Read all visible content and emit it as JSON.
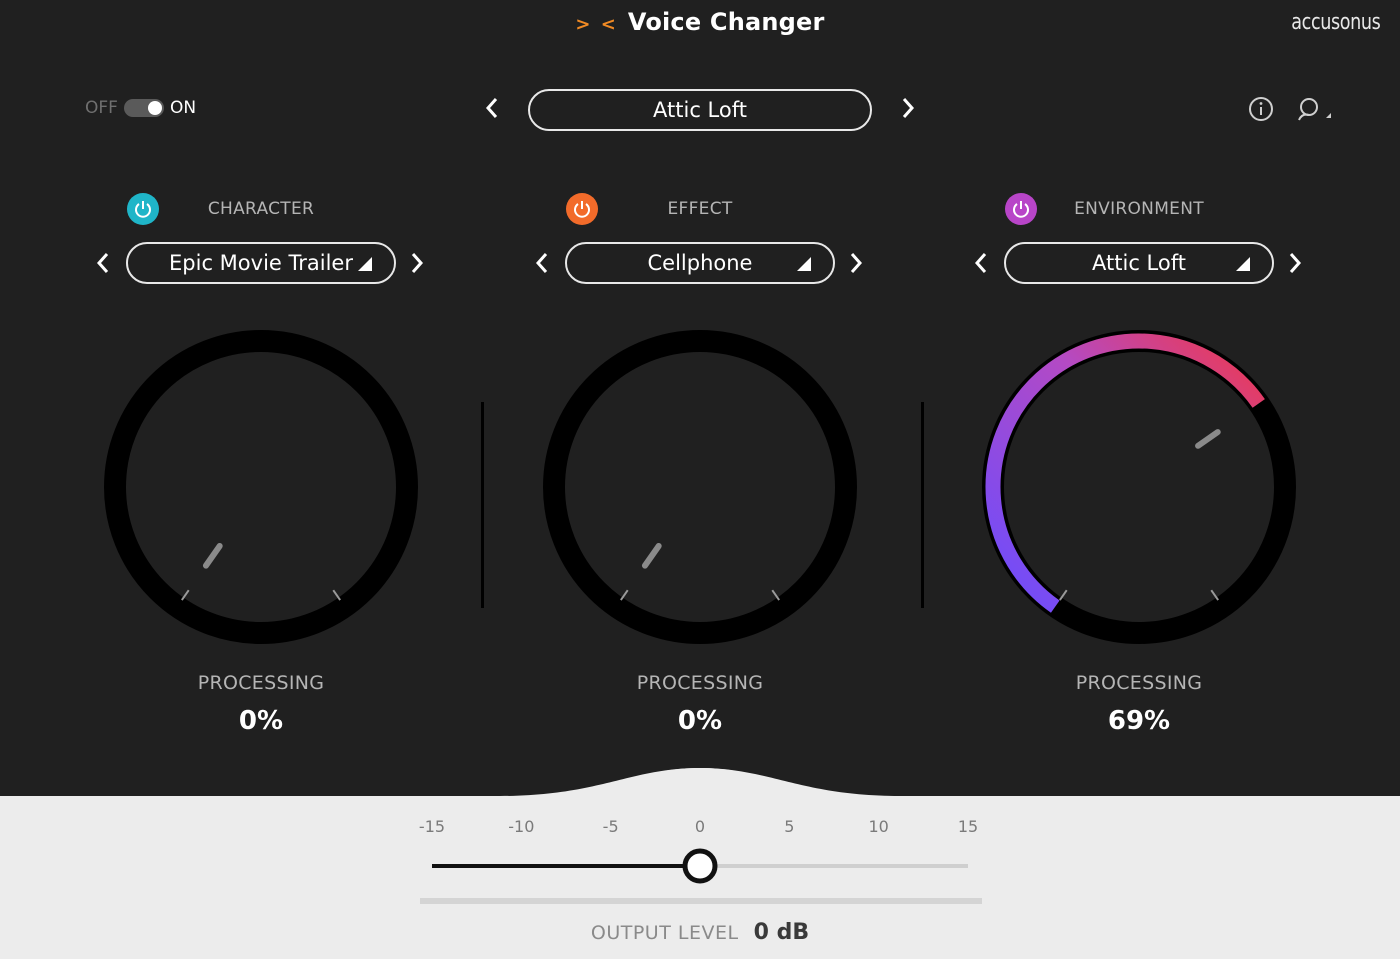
{
  "header": {
    "logo_glyph": "> <",
    "title": "Voice Changer",
    "brand": "accusonus"
  },
  "toggle": {
    "off_label": "OFF",
    "on_label": "ON",
    "state": "on"
  },
  "preset": {
    "name": "Attic Loft",
    "prev_icon": "chevron-left-icon",
    "next_icon": "chevron-right-icon"
  },
  "top_icons": {
    "info": "ⓘ",
    "search": "⚲"
  },
  "modules": [
    {
      "label": "CHARACTER",
      "power_color": "#1fb5c8",
      "selection": "Epic Movie Trailer",
      "processing_label": "PROCESSING",
      "processing_value": "0%",
      "processing": 0
    },
    {
      "label": "EFFECT",
      "power_color": "#f26b2a",
      "selection": "Cellphone",
      "processing_label": "PROCESSING",
      "processing_value": "0%",
      "processing": 0
    },
    {
      "label": "ENVIRONMENT",
      "power_color": "#b845c8",
      "selection": "Attic Loft",
      "processing_label": "PROCESSING",
      "processing_value": "69%",
      "processing": 69
    }
  ],
  "output": {
    "ticks": [
      "-15",
      "-10",
      "-5",
      "0",
      "5",
      "10",
      "15"
    ],
    "label": "OUTPUT LEVEL",
    "value": "0 dB",
    "level_db": 0,
    "min_db": -15,
    "max_db": 15
  },
  "colors": {
    "arc_start": "#6a4cff",
    "arc_mid": "#b44ac4",
    "arc_end": "#f0384a"
  }
}
